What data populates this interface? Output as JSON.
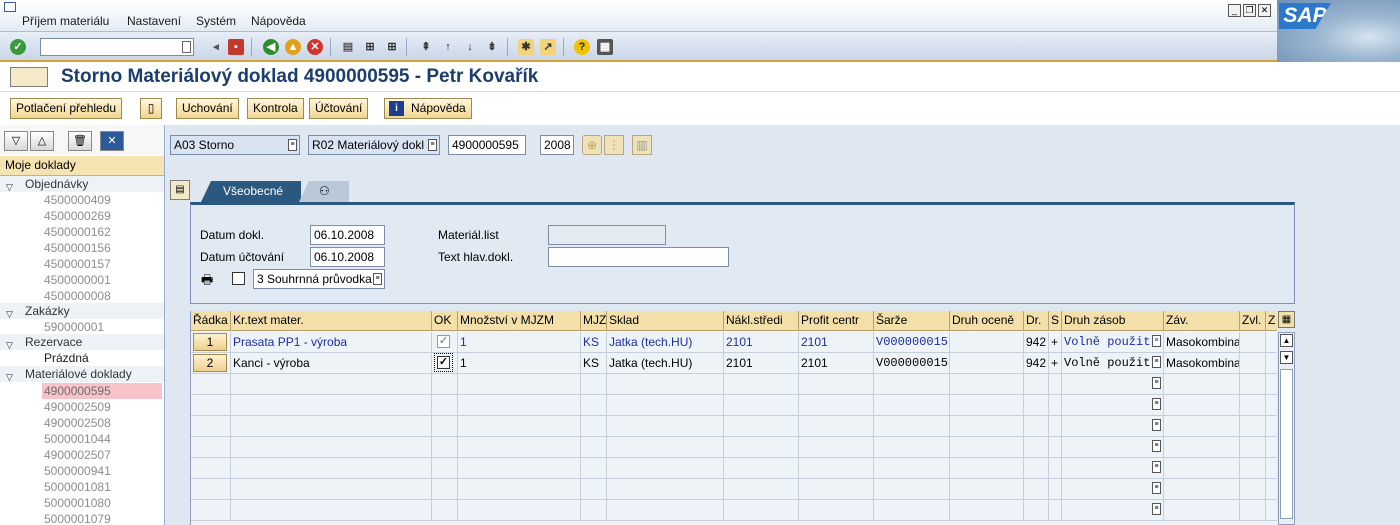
{
  "menu": [
    "Příjem materiálu",
    "Nastavení",
    "Systém",
    "Nápověda"
  ],
  "brand": "SAP",
  "page_title": "Storno Materiálový doklad 4900000595 - Petr Kovařík",
  "app_toolbar": {
    "overview": "Potlačení přehledu",
    "save": "Uchování",
    "check": "Kontrola",
    "post": "Účtování",
    "help": "Nápověda"
  },
  "header": {
    "action": "A03 Storno",
    "reference": "R02 Materiálový dokl",
    "doc_number": "4900000595",
    "year": "2008"
  },
  "tabs": {
    "general": "Všeobecné"
  },
  "general": {
    "doc_date_label": "Datum dokl.",
    "doc_date": "06.10.2008",
    "post_date_label": "Datum účtování",
    "post_date": "06.10.2008",
    "slip_option": "3 Souhrnná průvodka",
    "material_slip_label": "Materiál.list",
    "material_slip": "",
    "header_text_label": "Text hlav.dokl.",
    "header_text": ""
  },
  "nav": {
    "title": "Moje doklady",
    "sections": [
      {
        "label": "Objednávky",
        "items": [
          "4500000409",
          "4500000269",
          "4500000162",
          "4500000156",
          "4500000157",
          "4500000001",
          "4500000008"
        ]
      },
      {
        "label": "Zakázky",
        "items": [
          "590000001"
        ]
      },
      {
        "label": "Rezervace",
        "items": [
          "Prázdná"
        ]
      },
      {
        "label": "Materiálové doklady",
        "items": [
          "4900000595",
          "4900002509",
          "4900002508",
          "5000001044",
          "4900002507",
          "5000000941",
          "5000001081",
          "5000001080",
          "5000001079"
        ]
      }
    ],
    "selected": "4900000595"
  },
  "grid": {
    "columns": [
      "Řádka",
      "Kr.text mater.",
      "OK",
      "Množství v MJZM",
      "MJZ",
      "Sklad",
      "Nákl.středi",
      "Profit centr",
      "Šarže",
      "Druh oceně",
      "Dr.",
      "S",
      "Druh zásob",
      "Záv.",
      "Zvl.",
      "Z"
    ],
    "rows": [
      {
        "line": "1",
        "text": "Prasata PP1 - výroba",
        "ok": true,
        "ok_disabled": true,
        "qty": "1",
        "uom": "KS",
        "sloc": "Jatka (tech.HU)",
        "cc": "2101",
        "pc": "2101",
        "batch": "V000000015",
        "val": "",
        "mvt": "942",
        "s": "+",
        "stock": "Volně použit",
        "plant": "Masokombina",
        "special": ""
      },
      {
        "line": "2",
        "text": "Kanci - výroba",
        "ok": true,
        "ok_disabled": false,
        "qty": "1",
        "uom": "KS",
        "sloc": "Jatka (tech.HU)",
        "cc": "2101",
        "pc": "2101",
        "batch": "V000000015",
        "val": "",
        "mvt": "942",
        "s": "+",
        "stock": "Volně použit",
        "plant": "Masokombina",
        "special": ""
      }
    ]
  },
  "colors": {
    "title": "#1b3e6f",
    "tab_active": "#2b587f",
    "header_yellow": "#f3dfa9",
    "selection_pink": "#f7c2c8"
  }
}
